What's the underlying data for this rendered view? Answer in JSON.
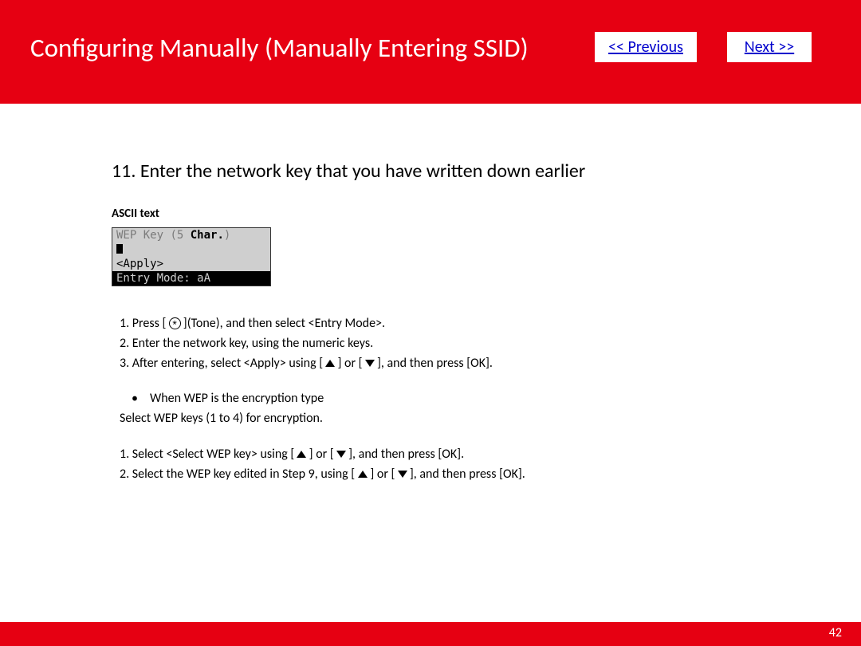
{
  "header": {
    "title": "Configuring Manually (Manually Entering SSID)",
    "prev_label": "<< Previous",
    "next_label": "Next >>"
  },
  "step": {
    "number": "11.",
    "text": "Enter the network key that you have written down earlier"
  },
  "ascii_label": "ASCII text",
  "lcd": {
    "line1_gray": "WEP Key ",
    "line1_dim_paren_open": "(",
    "line1_dim_5": "5 ",
    "line1_bold": "Char.",
    "line1_dim_paren_close": ")",
    "line3": "<Apply>",
    "line4": "Entry Mode: aA"
  },
  "instr": {
    "p1a": "1. Press [ ",
    "p1b": " ](Tone), and then select <Entry Mode>.",
    "p2": "2. Enter the network key, using the numeric keys.",
    "p3a": "3. After entering, select <Apply> using [ ",
    "p3b": " ] or [ ",
    "p3c": " ], and then press [OK].",
    "bullet": "When WEP is the encryption type",
    "p4": "Select WEP keys (1 to 4) for encryption.",
    "p5a": "1. Select <Select WEP key> using [ ",
    "p5b": " ] or [ ",
    "p5c": " ], and then press [OK].",
    "p6a": "2. Select the WEP key edited in Step 9, using [ ",
    "p6b": " ] or [ ",
    "p6c": " ], and then press [OK]."
  },
  "page_number": "42"
}
